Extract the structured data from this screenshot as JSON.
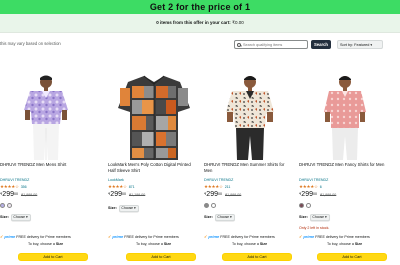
{
  "banner": {
    "title": "Get 2 for the price of 1"
  },
  "subbar": {
    "prefix": "0 items from this offer in your cart:",
    "amount": "₹0.00"
  },
  "filters": {
    "note": "this may vary based on selection"
  },
  "search": {
    "placeholder": "Search qualifying items",
    "button_label": "Search"
  },
  "sort": {
    "label": "Sort by: Featured"
  },
  "products": [
    {
      "title": "DHRUVI TRENDZ Men Mens Shirt",
      "brand": "DHRUVI TRENDZ",
      "stars": "★★★★☆",
      "rating_count": "356",
      "currency": "₹",
      "price": "299",
      "decimal": "00",
      "mrp": "₹1,999.00",
      "swatches": [
        "#b7b1e6",
        "#efe7f0"
      ],
      "size_label": "Size:",
      "size_value": "Choose",
      "stock": "",
      "prime": "prime",
      "prime_text": "FREE delivery for Prime members",
      "delivery_prefix": "To buy, choose a",
      "delivery_bold": "Size",
      "cart_label": "Add to Cart"
    },
    {
      "title": "LookMark Men's Poly Cotton Digital Printed Half Sleeve Shirt",
      "brand": "LookMark",
      "stars": "★★★★☆",
      "rating_count": "871",
      "currency": "₹",
      "price": "299",
      "decimal": "00",
      "mrp": "₹1,199.00",
      "swatches": [],
      "size_label": "Size:",
      "size_value": "Choose",
      "stock": "",
      "prime": "prime",
      "prime_text": "FREE delivery for Prime members",
      "delivery_prefix": "To buy, choose a",
      "delivery_bold": "Size",
      "cart_label": "Add to Cart"
    },
    {
      "title": "DHRUVI TRENDZ Men Summer Shirts for Men",
      "brand": "DHRUVI TRENDZ",
      "stars": "★★★★☆",
      "rating_count": "211",
      "currency": "₹",
      "price": "299",
      "decimal": "00",
      "mrp": "₹1,999.00",
      "swatches": [
        "#8a8a8a",
        "#ffffff"
      ],
      "size_label": "Size:",
      "size_value": "Choose",
      "stock": "",
      "prime": "prime",
      "prime_text": "FREE delivery for Prime members",
      "delivery_prefix": "To buy, choose a",
      "delivery_bold": "Size",
      "cart_label": "Add to Cart"
    },
    {
      "title": "DHRUVI TRENDZ Men Fancy Shirts for Men",
      "brand": "DHRUVI TRENDZ",
      "stars": "★★★★☆",
      "rating_count": "6",
      "currency": "₹",
      "price": "299",
      "decimal": "00",
      "mrp": "₹1,999.00",
      "swatches": [
        "#7a4b55",
        "#ffffff"
      ],
      "size_label": "Size:",
      "size_value": "Choose",
      "stock": "Only 2 left in stock.",
      "prime": "prime",
      "prime_text": "FREE delivery for Prime members",
      "delivery_prefix": "To buy, choose a",
      "delivery_bold": "Size",
      "cart_label": "Add to Cart"
    }
  ]
}
